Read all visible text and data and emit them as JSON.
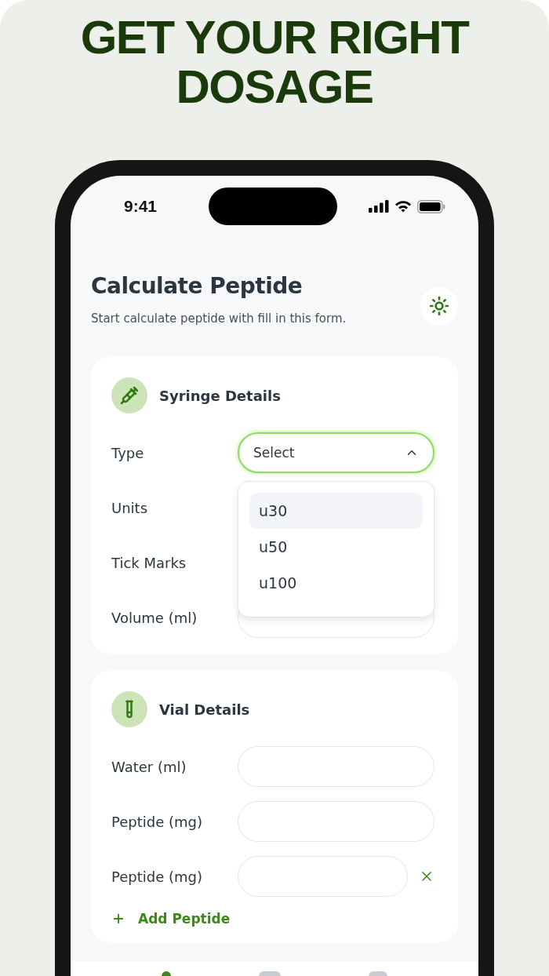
{
  "headline": [
    "GET YOUR RIGHT",
    "DOSAGE"
  ],
  "status_bar": {
    "time": "9:41"
  },
  "header": {
    "title": "Calculate Peptide",
    "subtitle": "Start calculate peptide with fill in this form."
  },
  "sections": [
    {
      "kind": "syringe",
      "title": "Syringe Details",
      "fields": [
        {
          "label": "Type",
          "kind": "select",
          "value": "Select",
          "expanded": true,
          "options": [
            {
              "label": "u30",
              "selected": true
            },
            {
              "label": "u50",
              "selected": false
            },
            {
              "label": "u100",
              "selected": false
            }
          ]
        },
        {
          "label": "Units",
          "kind": "covered"
        },
        {
          "label": "Tick Marks",
          "kind": "covered"
        },
        {
          "label": "Volume (ml)",
          "kind": "input"
        }
      ]
    },
    {
      "kind": "vial",
      "title": "Vial Details",
      "fields": [
        {
          "label": "Water (ml)",
          "kind": "input"
        },
        {
          "label": "Peptide (mg)",
          "kind": "input"
        },
        {
          "label": "Peptide (mg)",
          "kind": "input",
          "removable": true
        }
      ],
      "add_button": "Add Peptide"
    }
  ]
}
